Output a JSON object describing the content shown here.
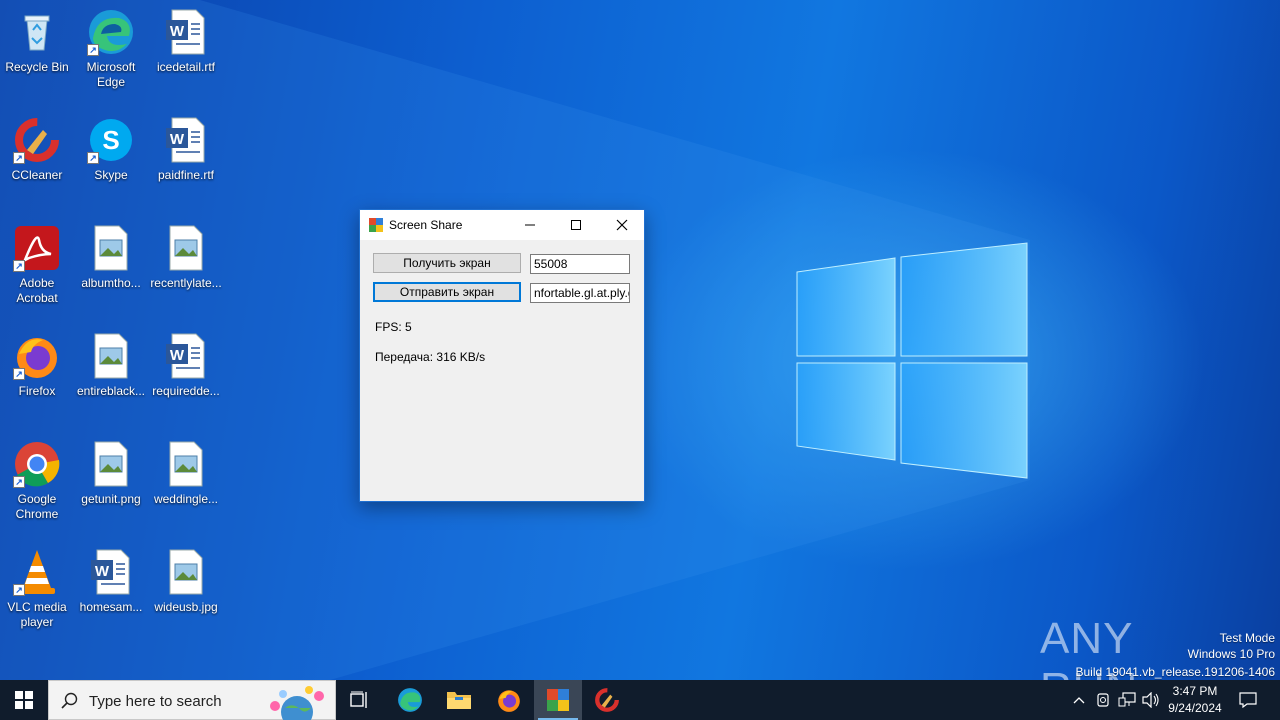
{
  "desktop": {
    "icons": [
      {
        "label": "Recycle Bin",
        "icon": "recycle-bin-icon"
      },
      {
        "label": "Microsoft Edge",
        "icon": "edge-icon"
      },
      {
        "label": "icedetail.rtf",
        "icon": "word-doc-icon"
      },
      {
        "label": "CCleaner",
        "icon": "ccleaner-icon"
      },
      {
        "label": "Skype",
        "icon": "skype-icon"
      },
      {
        "label": "paidfine.rtf",
        "icon": "word-doc-icon"
      },
      {
        "label": "Adobe Acrobat",
        "icon": "acrobat-icon"
      },
      {
        "label": "albumtho...",
        "icon": "image-file-icon"
      },
      {
        "label": "recentlylate...",
        "icon": "image-file-icon"
      },
      {
        "label": "Firefox",
        "icon": "firefox-icon"
      },
      {
        "label": "entireblack...",
        "icon": "image-file-icon"
      },
      {
        "label": "requiredde...",
        "icon": "word-doc-icon"
      },
      {
        "label": "Google Chrome",
        "icon": "chrome-icon"
      },
      {
        "label": "getunit.png",
        "icon": "image-file-icon"
      },
      {
        "label": "weddingle...",
        "icon": "image-file-icon"
      },
      {
        "label": "VLC media player",
        "icon": "vlc-icon"
      },
      {
        "label": "homesam...",
        "icon": "word-doc-icon"
      },
      {
        "label": "wideusb.jpg",
        "icon": "image-file-icon"
      }
    ]
  },
  "window": {
    "title": "Screen Share",
    "get_screen_label": "Получить экран",
    "send_screen_label": "Отправить экран",
    "port_value": "55008",
    "host_value": "nfortable.gl.at.ply.gg",
    "fps_text": "FPS: 5",
    "transfer_text": "Передача: 316 KB/s"
  },
  "watermark": {
    "brand": "ANY RUN",
    "mode": "Test Mode",
    "edition": "Windows 10 Pro",
    "build": "Build 19041.vb_release.191206-1406"
  },
  "taskbar": {
    "search_placeholder": "Type here to search",
    "time": "3:47 PM",
    "date": "9/24/2024"
  },
  "colors": {
    "accent": "#0078d7",
    "taskbar": "#101c2c",
    "desktop": "#0d5fd0"
  }
}
